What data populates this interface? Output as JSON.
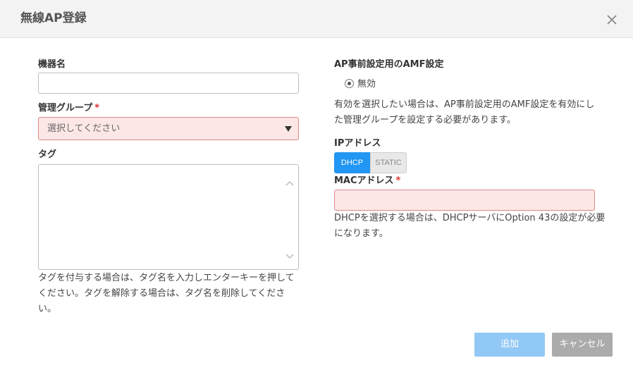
{
  "dialog": {
    "title": "無線AP登録",
    "close_icon": "close-icon"
  },
  "form": {
    "device_name": {
      "label": "機器名",
      "value": ""
    },
    "management_group": {
      "label": "管理グループ",
      "required_mark": "*",
      "selected": "選択してください"
    },
    "tags": {
      "label": "タグ",
      "value": "",
      "help_lines": [
        "タグを付与する場合は、タグ名を入力しエンターキーを押して",
        "ください。タグを解除する場合は、タグ名を削除してくださ",
        "い。"
      ]
    },
    "amf": {
      "label": "AP事前設定用のAMF設定",
      "option_label": "無効",
      "help_lines": [
        "有効を選択したい場合は、AP事前設定用のAMF設定を有効にし",
        "た管理グループを設定する必要があります。"
      ]
    },
    "ip_address": {
      "label": "IPアドレス",
      "options": [
        "DHCP",
        "STATIC"
      ],
      "selected": "DHCP"
    },
    "mac_address": {
      "label": "MACアドレス",
      "required_mark": "*",
      "value": "",
      "help_lines": [
        "DHCPを選択する場合は、DHCPサーバにOption 43の設定が必要",
        "になります。"
      ]
    }
  },
  "actions": {
    "add_label": "追加",
    "cancel_label": "キャンセル"
  },
  "colors": {
    "accent": "#2196f3",
    "error_bg": "#fde6e6",
    "error_border": "#d98888",
    "required": "#e03030"
  }
}
